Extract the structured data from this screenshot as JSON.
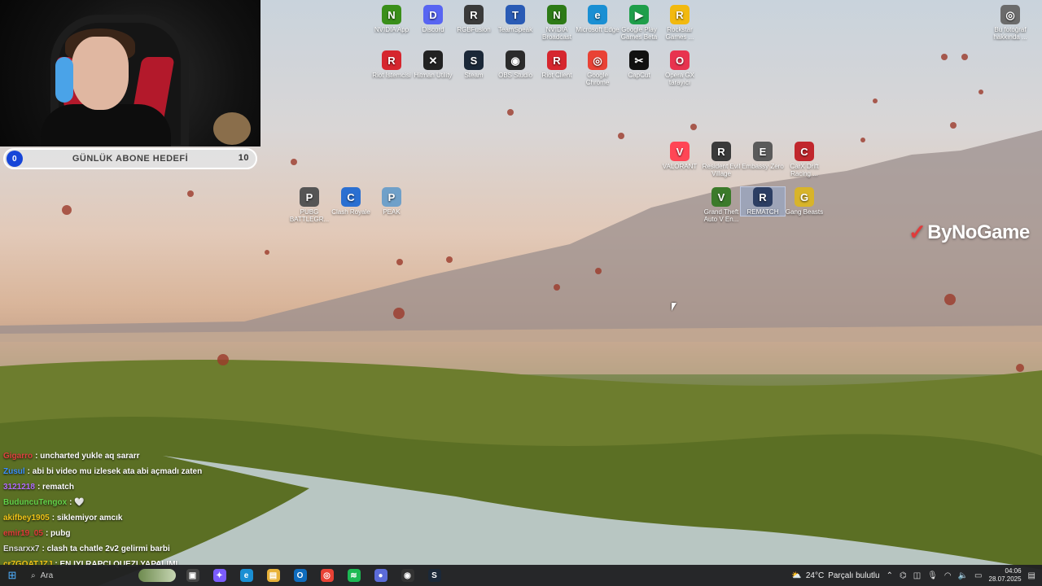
{
  "desktop": {
    "icons": [
      {
        "label": "NVIDIA App",
        "glyph": "N",
        "color": "#3a8f1a"
      },
      {
        "label": "Discord",
        "glyph": "D",
        "color": "#5865f2"
      },
      {
        "label": "RGBFusion",
        "glyph": "R",
        "color": "#3a3a3a"
      },
      {
        "label": "TeamSpeak",
        "glyph": "T",
        "color": "#2a5bb5"
      },
      {
        "label": "NVIDIA Broadcast",
        "glyph": "N",
        "color": "#2d7a16"
      },
      {
        "label": "Microsoft Edge",
        "glyph": "e",
        "color": "#1a8fd3"
      },
      {
        "label": "Google Play Games Beta",
        "glyph": "▶",
        "color": "#1e9e4a"
      },
      {
        "label": "Rockstar Games ...",
        "glyph": "R",
        "color": "#f2b90f"
      },
      {
        "label": "Riot İstemcisi",
        "glyph": "R",
        "color": "#d6262e"
      },
      {
        "label": "Hitman Utility",
        "glyph": "✕",
        "color": "#222"
      },
      {
        "label": "Steam",
        "glyph": "S",
        "color": "#1b2838"
      },
      {
        "label": "OBS Studio",
        "glyph": "◉",
        "color": "#2b2b2b"
      },
      {
        "label": "Riot Client",
        "glyph": "R",
        "color": "#d6262e"
      },
      {
        "label": "Google Chrome",
        "glyph": "◎",
        "color": "#e94235"
      },
      {
        "label": "CapCut",
        "glyph": "✂",
        "color": "#111"
      },
      {
        "label": "Opera GX tarayıcı",
        "glyph": "O",
        "color": "#e8334f"
      },
      {
        "label": "VALORANT",
        "glyph": "V",
        "color": "#ff4655"
      },
      {
        "label": "Resident Evil Village",
        "glyph": "R",
        "color": "#3a3a3a"
      },
      {
        "label": "Embassy Zero",
        "glyph": "E",
        "color": "#5a5a5a"
      },
      {
        "label": "CarX Drift Racing ...",
        "glyph": "C",
        "color": "#c1272d"
      },
      {
        "label": "PUBG BATTLEGR...",
        "glyph": "P",
        "color": "#555"
      },
      {
        "label": "Clash Royale",
        "glyph": "C",
        "color": "#2a6fd1"
      },
      {
        "label": "PEAK",
        "glyph": "P",
        "color": "#6fa0c9"
      },
      {
        "label": "Grand Theft Auto V En...",
        "glyph": "V",
        "color": "#3b7a2a"
      },
      {
        "label": "REMATCH",
        "glyph": "R",
        "color": "#2c3e63"
      },
      {
        "label": "Gang Beasts",
        "glyph": "G",
        "color": "#d8b42a"
      },
      {
        "label": "Bu fotoğraf hakkında ...",
        "glyph": "◎",
        "color": "#6b6b6b"
      }
    ],
    "brand": "ByNoGame"
  },
  "stream": {
    "goal_title": "GÜNLÜK ABONE HEDEFİ",
    "goal_current": "0",
    "goal_target": "10",
    "chat": [
      {
        "user": "Gigarro",
        "color": "#e04040",
        "message": ": uncharted yukle aq sararr"
      },
      {
        "user": "Zusul",
        "color": "#3b8fff",
        "message": ": abi bi video mu izlesek ata abi açmadı zaten"
      },
      {
        "user": "3121218",
        "color": "#b36cff",
        "message": ": rematch"
      },
      {
        "user": "BuduncuTengox",
        "color": "#63d34a",
        "message": ": 🤍"
      },
      {
        "user": "akifbey1905",
        "color": "#f0c419",
        "message": ": siklemiyor amcık"
      },
      {
        "user": "emir19_05",
        "color": "#e03a3a",
        "message": ": pubg"
      },
      {
        "user": "Ensarxx7",
        "color": "#dddddd",
        "message": ": clash ta chatle 2v2 gelirmi barbi"
      },
      {
        "user": "cr7GOATJZJ",
        "color": "#f0c419",
        "message": ": EN IYI RAPCI QUEZI YAPALIMI"
      }
    ]
  },
  "taskbar": {
    "search_placeholder": "Ara",
    "apps": [
      {
        "name": "task-view",
        "glyph": "▣",
        "color": "#444"
      },
      {
        "name": "copilot",
        "glyph": "✦",
        "color": "#7b5cff"
      },
      {
        "name": "edge",
        "glyph": "e",
        "color": "#1a8fd3"
      },
      {
        "name": "file-explorer",
        "glyph": "▤",
        "color": "#e8b23a"
      },
      {
        "name": "outlook",
        "glyph": "O",
        "color": "#0f6cbd"
      },
      {
        "name": "chrome",
        "glyph": "◎",
        "color": "#e94235"
      },
      {
        "name": "spotify",
        "glyph": "≋",
        "color": "#1db954"
      },
      {
        "name": "app-blue",
        "glyph": "●",
        "color": "#5b6bd8"
      },
      {
        "name": "obs",
        "glyph": "◉",
        "color": "#333"
      },
      {
        "name": "steam",
        "glyph": "S",
        "color": "#1b2838"
      }
    ],
    "weather_temp": "24°C",
    "weather_desc": "Parçalı bulutlu",
    "time": "04:06",
    "date": "28.07.2025"
  }
}
